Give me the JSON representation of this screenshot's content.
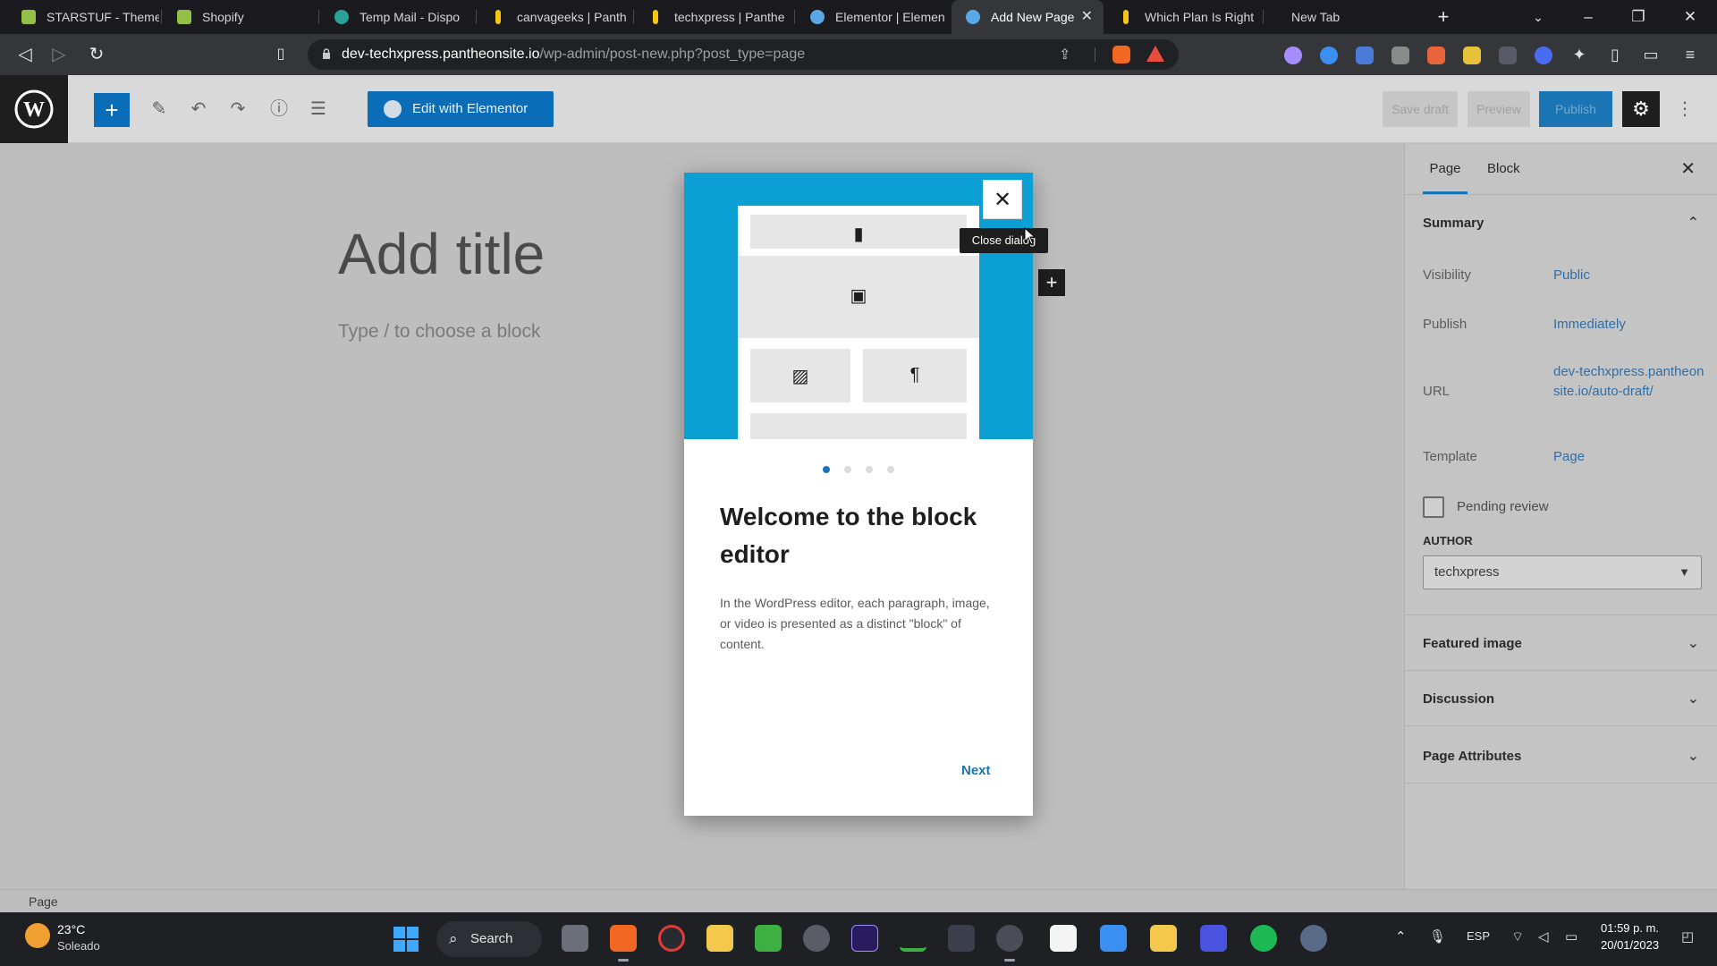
{
  "browser": {
    "tabs": [
      {
        "title": "STARSTUF - Theme",
        "color": "#95bf47"
      },
      {
        "title": "Shopify",
        "color": "#95bf47"
      },
      {
        "title": "Temp Mail - Dispo",
        "color": "#2aa198"
      },
      {
        "title": "canvageeks | Panth",
        "color": "#f3c613"
      },
      {
        "title": "techxpress | Panthe",
        "color": "#f3c613"
      },
      {
        "title": "Elementor | Elemen",
        "color": "#5aa7e6"
      },
      {
        "title": "Add New Page",
        "color": "#5aa7e6"
      },
      {
        "title": "Which Plan Is Right",
        "color": "#f3c613"
      },
      {
        "title": "New Tab",
        "color": ""
      }
    ],
    "new_tab_label": "+",
    "url_host": "dev-techxpress.pantheonsite.io",
    "url_path": "/wp-admin/post-new.php?post_type=page"
  },
  "editor": {
    "edit_with_elementor": "Edit with Elementor",
    "save_draft": "Save draft",
    "preview": "Preview",
    "publish": "Publish",
    "title_placeholder": "Add title",
    "block_hint": "Type / to choose a block",
    "status_bar": "Page"
  },
  "sidebar": {
    "tab_page": "Page",
    "tab_block": "Block",
    "summary_title": "Summary",
    "visibility_label": "Visibility",
    "visibility_value": "Public",
    "publish_label": "Publish",
    "publish_value": "Immediately",
    "url_label": "URL",
    "url_value": "dev-techxpress.pantheonsite.io/auto-draft/",
    "template_label": "Template",
    "template_value": "Page",
    "pending_review": "Pending review",
    "author_label": "AUTHOR",
    "author_value": "techxpress",
    "featured_image": "Featured image",
    "discussion": "Discussion",
    "page_attributes": "Page Attributes"
  },
  "modal": {
    "close_tooltip": "Close dialog",
    "heading": "Welcome to the block editor",
    "body": "In the WordPress editor, each paragraph, image, or video is presented as a distinct \"block\" of content.",
    "next": "Next",
    "pages_total": 4,
    "page_current": 1
  },
  "taskbar": {
    "temperature": "23°C",
    "condition": "Soleado",
    "search": "Search",
    "language": "ESP",
    "time": "01:59 p. m.",
    "date": "20/01/2023"
  },
  "colors": {
    "wp_blue": "#1b74b4",
    "guide_blue": "#0b9fd4"
  }
}
